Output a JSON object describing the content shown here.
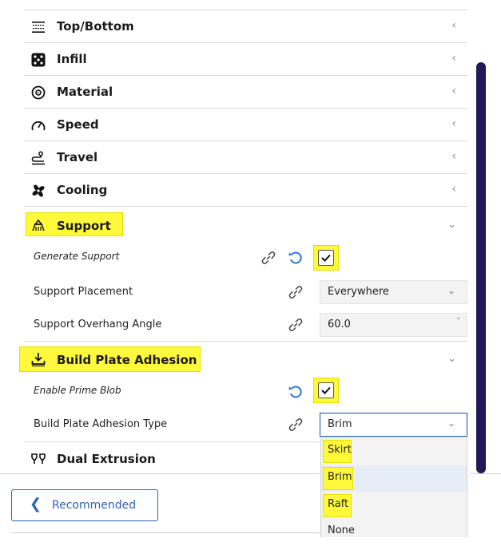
{
  "categories": [
    {
      "label": "Top/Bottom",
      "icon": "top-bottom-icon"
    },
    {
      "label": "Infill",
      "icon": "infill-icon"
    },
    {
      "label": "Material",
      "icon": "material-icon"
    },
    {
      "label": "Speed",
      "icon": "speed-icon"
    },
    {
      "label": "Travel",
      "icon": "travel-icon"
    },
    {
      "label": "Cooling",
      "icon": "cooling-icon"
    },
    {
      "label": "Support",
      "icon": "support-icon"
    },
    {
      "label": "Build Plate Adhesion",
      "icon": "build-plate-adhesion-icon"
    },
    {
      "label": "Dual Extrusion",
      "icon": "dual-extrusion-icon"
    }
  ],
  "support_settings": {
    "generate_support": {
      "label": "Generate Support",
      "checked": true
    },
    "placement": {
      "label": "Support Placement",
      "value": "Everywhere"
    },
    "overhang": {
      "label": "Support Overhang Angle",
      "value": "60.0",
      "unit": "°"
    }
  },
  "adhesion_settings": {
    "prime_blob": {
      "label": "Enable Prime Blob",
      "checked": true
    },
    "type": {
      "label": "Build Plate Adhesion Type",
      "value": "Brim"
    }
  },
  "adhesion_options": [
    "Skirt",
    "Brim",
    "Raft",
    "None"
  ],
  "recommended_label": "Recommended",
  "colors": {
    "highlight": "#fff93c",
    "accent": "#2d63b8",
    "scrollbar": "#1e1a57"
  }
}
